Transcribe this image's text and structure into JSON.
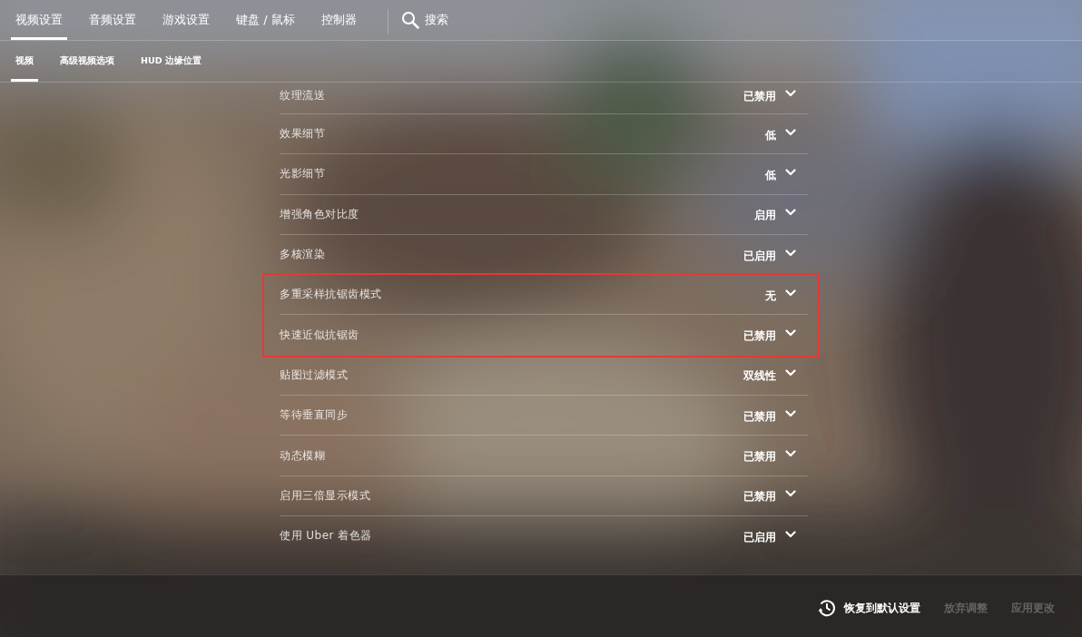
{
  "tabs": [
    {
      "label": "视频设置",
      "selected": true
    },
    {
      "label": "音频设置",
      "selected": false
    },
    {
      "label": "游戏设置",
      "selected": false
    },
    {
      "label": "键盘 / 鼠标",
      "selected": false
    },
    {
      "label": "控制器",
      "selected": false
    }
  ],
  "search": {
    "label": "搜索"
  },
  "subtabs": [
    {
      "label": "视频",
      "selected": true
    },
    {
      "label": "高级视频选项",
      "selected": false
    },
    {
      "label": "HUD 边缘位置",
      "selected": false
    }
  ],
  "settings": [
    {
      "label": "纹理流送",
      "value": "已禁用",
      "highlighted": false
    },
    {
      "label": "效果细节",
      "value": "低",
      "highlighted": false
    },
    {
      "label": "光影细节",
      "value": "低",
      "highlighted": false
    },
    {
      "label": "增强角色对比度",
      "value": "启用",
      "highlighted": false
    },
    {
      "label": "多核渲染",
      "value": "已启用",
      "highlighted": false
    },
    {
      "label": "多重采样抗锯齿模式",
      "value": "无",
      "highlighted": true
    },
    {
      "label": "快速近似抗锯齿",
      "value": "已禁用",
      "highlighted": true
    },
    {
      "label": "贴图过滤模式",
      "value": "双线性",
      "highlighted": false
    },
    {
      "label": "等待垂直同步",
      "value": "已禁用",
      "highlighted": false
    },
    {
      "label": "动态模糊",
      "value": "已禁用",
      "highlighted": false
    },
    {
      "label": "启用三倍显示模式",
      "value": "已禁用",
      "highlighted": false
    },
    {
      "label": "使用 Uber 着色器",
      "value": "已启用",
      "highlighted": false
    }
  ],
  "footer": {
    "reset": {
      "label": "恢复到默认设置"
    },
    "buttons": [
      {
        "label": "放弃调整",
        "disabled": true
      },
      {
        "label": "应用更改",
        "disabled": true
      }
    ]
  }
}
